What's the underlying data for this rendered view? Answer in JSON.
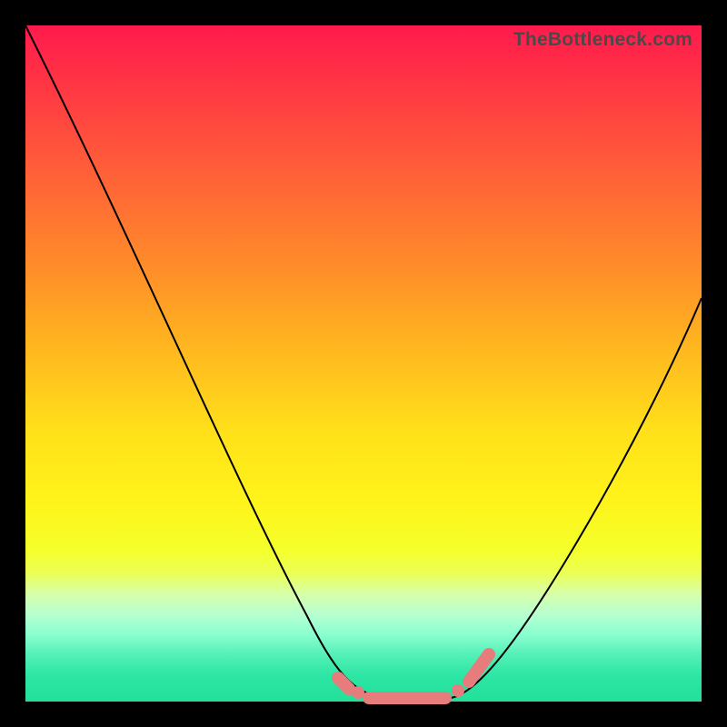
{
  "brand": "TheBottleneck.com",
  "colors": {
    "frame": "#000000",
    "curve": "#000000",
    "marker": "#e77c7c"
  },
  "chart_data": {
    "type": "line",
    "title": "",
    "xlabel": "",
    "ylabel": "",
    "xlim": [
      0,
      100
    ],
    "ylim": [
      0,
      100
    ],
    "series": [
      {
        "name": "bottleneck-curve",
        "x": [
          0,
          5,
          10,
          15,
          20,
          25,
          30,
          35,
          40,
          45,
          48,
          50,
          52,
          55,
          58,
          60,
          62,
          65,
          70,
          75,
          80,
          85,
          90,
          95,
          100
        ],
        "y": [
          100,
          90,
          79,
          68,
          57,
          46,
          35,
          25,
          16,
          8,
          4,
          1.5,
          0.5,
          0,
          0,
          0,
          0.5,
          2,
          7,
          14,
          22,
          31,
          40,
          50,
          60
        ]
      }
    ],
    "markers": {
      "flat_segment": {
        "x": [
          50,
          62
        ],
        "y": 0
      },
      "left_tick": {
        "x": 46,
        "y": 3
      },
      "right_tick": {
        "x": 65,
        "y": 4
      },
      "right_tick2": {
        "x": 68,
        "y": 7
      },
      "left_dot": {
        "x": 48,
        "y": 1.5
      },
      "right_dot": {
        "x": 63.5,
        "y": 1.5
      }
    },
    "background_gradient": [
      {
        "stop": 0.0,
        "color": "#ff1a4d"
      },
      {
        "stop": 0.35,
        "color": "#ff8a2a"
      },
      {
        "stop": 0.7,
        "color": "#fff31a"
      },
      {
        "stop": 1.0,
        "color": "#22e09a"
      }
    ]
  }
}
